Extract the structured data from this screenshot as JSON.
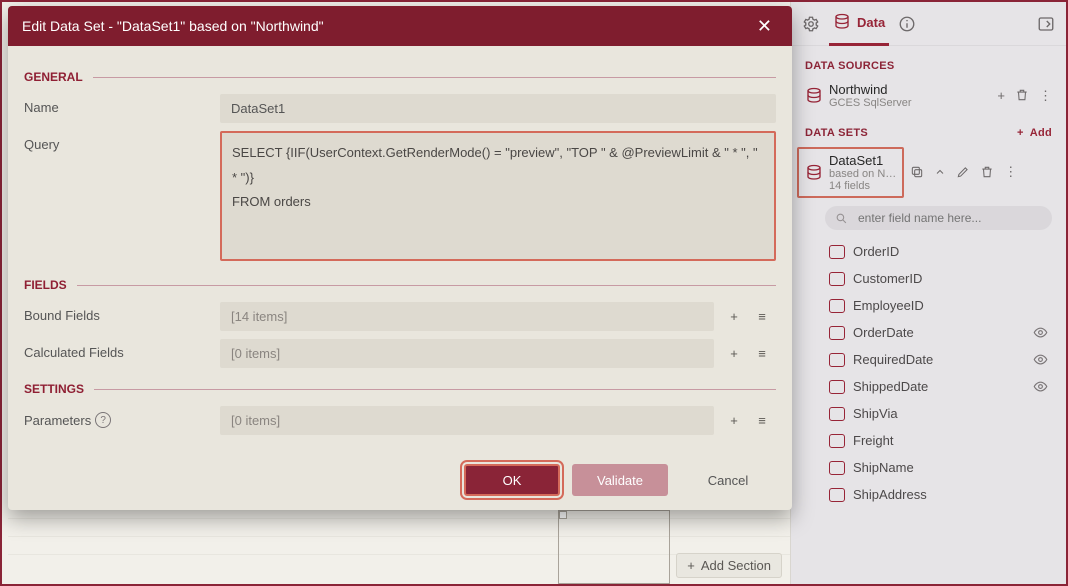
{
  "modal": {
    "title": "Edit Data Set - \"DataSet1\" based on \"Northwind\"",
    "sections": {
      "general": "GENERAL",
      "fields": "FIELDS",
      "settings": "SETTINGS"
    },
    "name_label": "Name",
    "name_value": "DataSet1",
    "query_label": "Query",
    "query_value": "SELECT {IIF(UserContext.GetRenderMode() = \"preview\", \"TOP \" & @PreviewLimit & \" * \", \" * \")}\nFROM orders",
    "bound_label": "Bound Fields",
    "bound_value": "[14 items]",
    "calc_label": "Calculated Fields",
    "calc_value": "[0 items]",
    "param_label": "Parameters",
    "param_value": "[0 items]",
    "buttons": {
      "ok": "OK",
      "validate": "Validate",
      "cancel": "Cancel"
    }
  },
  "right": {
    "tab_data": "Data",
    "data_sources_title": "DATA SOURCES",
    "datasource": {
      "name": "Northwind",
      "sub": "GCES SqlServer"
    },
    "data_sets_title": "DATA SETS",
    "add_label": "Add",
    "dataset": {
      "name": "DataSet1",
      "sub": "based on N…",
      "sub2": "14 fields"
    },
    "search_placeholder": "enter field name here...",
    "fields": [
      "OrderID",
      "CustomerID",
      "EmployeeID",
      "OrderDate",
      "RequiredDate",
      "ShippedDate",
      "ShipVia",
      "Freight",
      "ShipName",
      "ShipAddress"
    ],
    "visible_eye_indices": [
      3,
      4,
      5
    ]
  },
  "canvas": {
    "add_section": "Add Section"
  }
}
